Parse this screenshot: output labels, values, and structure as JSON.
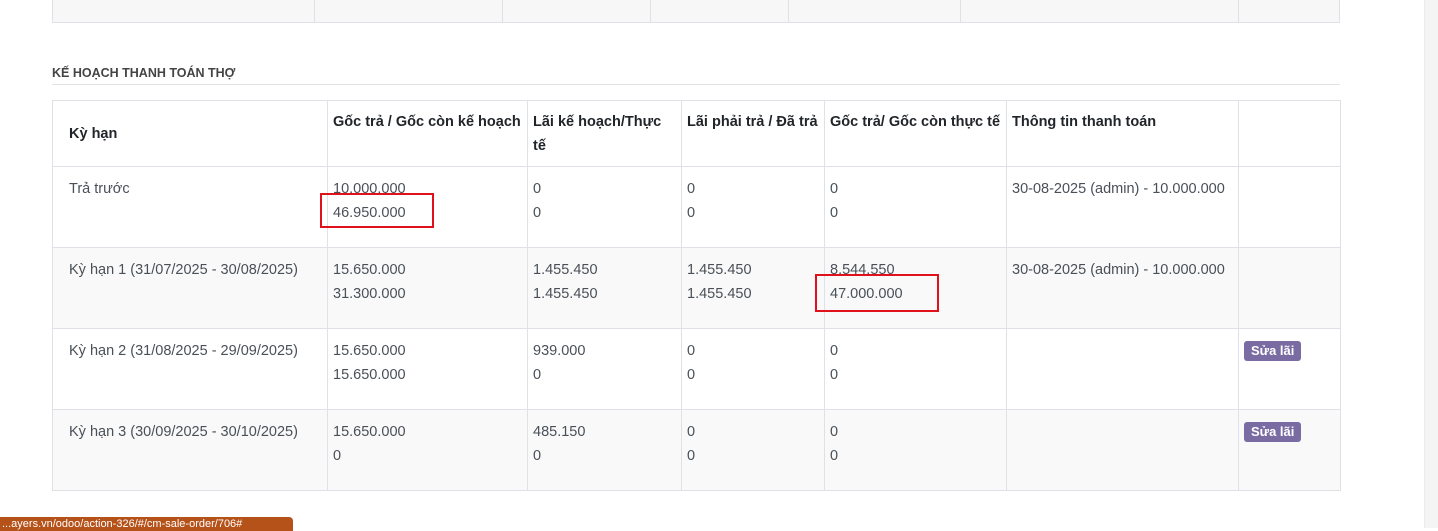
{
  "section_title": "KẾ HOẠCH THANH TOÁN THỢ",
  "columns": [
    "Kỳ hạn",
    "Gốc trả / Gốc còn kế hoạch",
    "Lãi kế hoạch/Thực tế",
    "Lãi phải trả / Đã trả",
    "Gốc trả/ Gốc còn thực tế",
    "Thông tin thanh toán",
    ""
  ],
  "rows": [
    {
      "term": "Trả trước",
      "plan_principal": [
        "10.000.000",
        "46.950.000"
      ],
      "interest_plan_actual": [
        "0",
        "0"
      ],
      "interest_due_paid": [
        "0",
        "0"
      ],
      "actual_principal": [
        "0",
        "0"
      ],
      "payment_info": "30-08-2025 (admin) - 10.000.000",
      "action": ""
    },
    {
      "term": "Kỳ hạn 1 (31/07/2025 - 30/08/2025)",
      "plan_principal": [
        "15.650.000",
        "31.300.000"
      ],
      "interest_plan_actual": [
        "1.455.450",
        "1.455.450"
      ],
      "interest_due_paid": [
        "1.455.450",
        "1.455.450"
      ],
      "actual_principal": [
        "8.544.550",
        "47.000.000"
      ],
      "payment_info": "30-08-2025 (admin) - 10.000.000",
      "action": ""
    },
    {
      "term": "Kỳ hạn 2 (31/08/2025 - 29/09/2025)",
      "plan_principal": [
        "15.650.000",
        "15.650.000"
      ],
      "interest_plan_actual": [
        "939.000",
        "0"
      ],
      "interest_due_paid": [
        "0",
        "0"
      ],
      "actual_principal": [
        "0",
        "0"
      ],
      "payment_info": "",
      "action": "Sửa lãi"
    },
    {
      "term": "Kỳ hạn 3 (30/09/2025 - 30/10/2025)",
      "plan_principal": [
        "15.650.000",
        "0"
      ],
      "interest_plan_actual": [
        "485.150",
        "0"
      ],
      "interest_due_paid": [
        "0",
        "0"
      ],
      "actual_principal": [
        "0",
        "0"
      ],
      "payment_info": "",
      "action": "Sửa lãi"
    }
  ],
  "status_bar_url": "...ayers.vn/odoo/action-326/#/cm-sale-order/706#",
  "colors": {
    "highlight_box": "#e0111b",
    "edit_button": "#7b6ba3",
    "status_bar": "#b5521a"
  }
}
